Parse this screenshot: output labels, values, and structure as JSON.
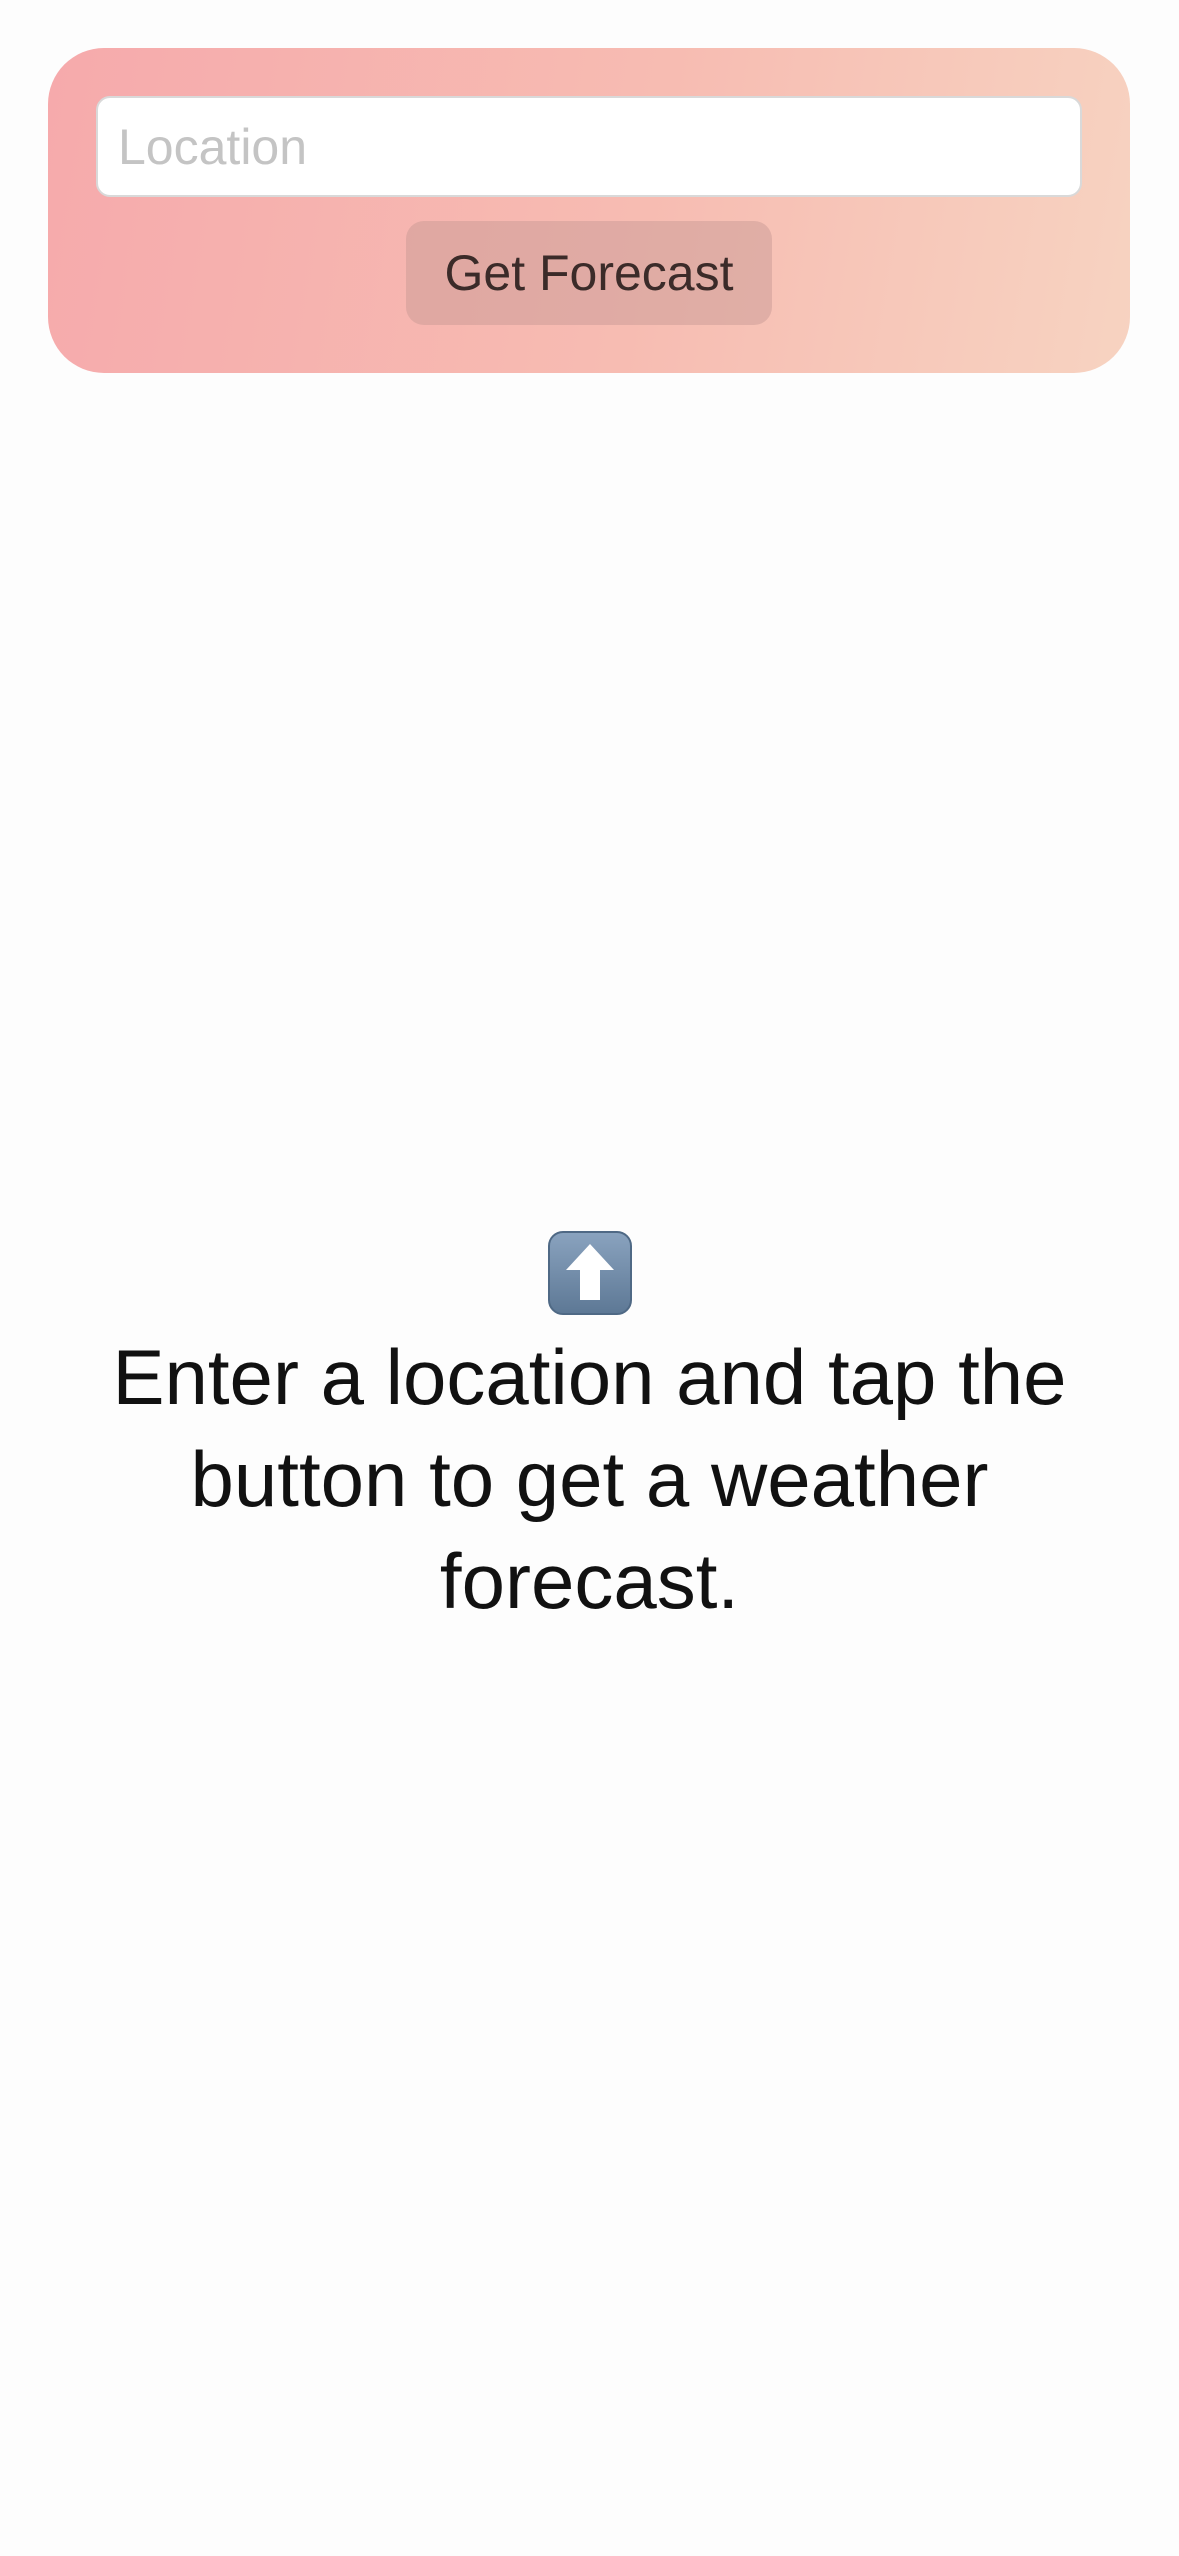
{
  "search": {
    "placeholder": "Location",
    "value": "",
    "button_label": "Get Forecast"
  },
  "empty_state": {
    "icon": "up-arrow-icon",
    "message": "Enter a location and tap the button to get a weather forecast."
  },
  "colors": {
    "card_gradient_start": "#f6aaac",
    "card_gradient_end": "#f7d3c1",
    "button_text": "#3b2b29",
    "arrow_tile": "#6f89a6"
  }
}
